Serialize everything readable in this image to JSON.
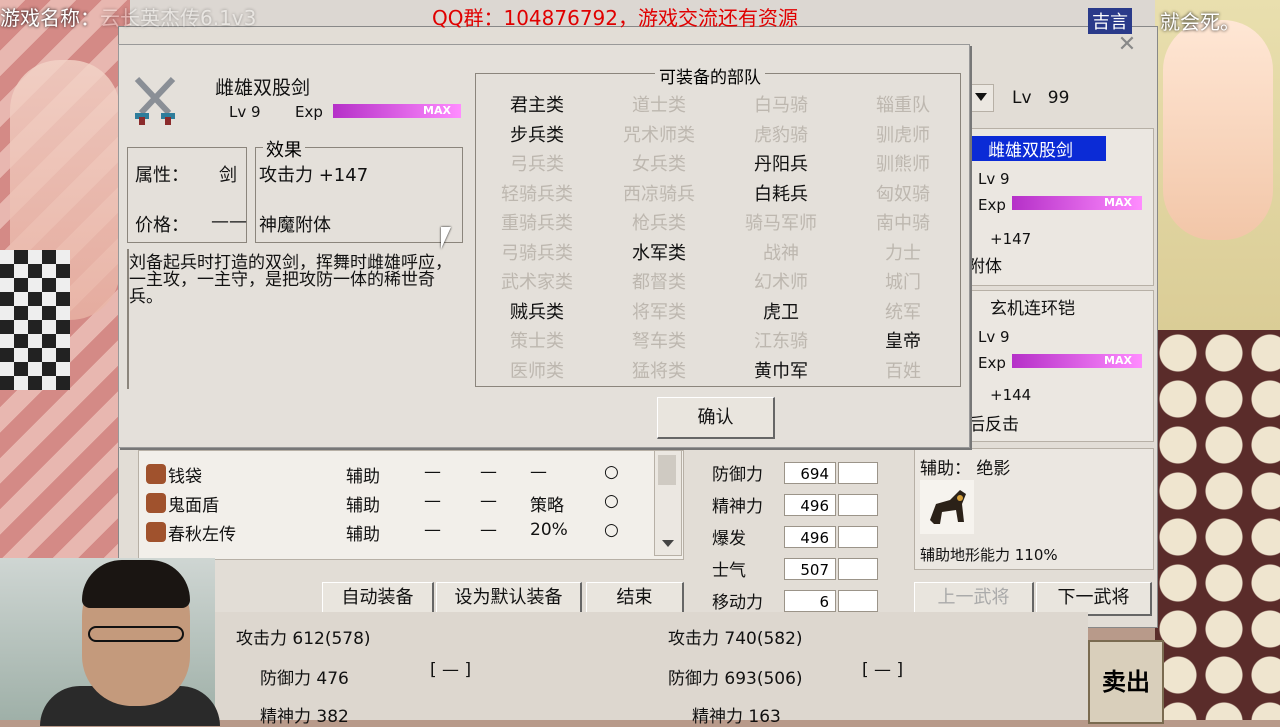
{
  "overlay": {
    "game_title": "游戏名称：",
    "game_name_partial": "云长英杰传6.1v3",
    "qq_banner": "QQ群：104876792，游戏交流还有资源",
    "right_caption": "就会死。",
    "right_tag": "吉言"
  },
  "modal": {
    "item_name": "雌雄双股剑",
    "lv_label": "Lv",
    "lv_value": "9",
    "exp_label": "Exp",
    "exp_max": "MAX",
    "attr_label": "属性：",
    "attr_value": "剑",
    "price_label": "价格：",
    "price_value": "——",
    "effect_title": "效果",
    "effect_line1": "攻击力 +147",
    "effect_line2": "神魔附体",
    "description": "刘备起兵时打造的双剑，挥舞时雌雄呼应，一主攻，一主守，是把攻防一体的稀世奇兵。",
    "units_title": "可装备的部队",
    "confirm_label": "确认",
    "units": [
      [
        "君主类",
        "道士类",
        "白马骑",
        "辎重队"
      ],
      [
        "步兵类",
        "咒术师类",
        "虎豹骑",
        "驯虎师"
      ],
      [
        "弓兵类",
        "女兵类",
        "丹阳兵",
        "驯熊师"
      ],
      [
        "轻骑兵类",
        "西凉骑兵",
        "白耗兵",
        "匈奴骑"
      ],
      [
        "重骑兵类",
        "枪兵类",
        "骑马军师",
        "南中骑"
      ],
      [
        "弓骑兵类",
        "水军类",
        "战神",
        "力士"
      ],
      [
        "武术家类",
        "都督类",
        "幻术师",
        "城门"
      ],
      [
        "贼兵类",
        "将军类",
        "虎卫",
        "统军"
      ],
      [
        "策士类",
        "弩车类",
        "江东骑",
        "皇帝"
      ],
      [
        "医师类",
        "猛将类",
        "黄巾军",
        "百姓"
      ]
    ],
    "units_enabled": [
      [
        true,
        false,
        false,
        false
      ],
      [
        true,
        false,
        false,
        false
      ],
      [
        false,
        false,
        true,
        false
      ],
      [
        false,
        false,
        true,
        false
      ],
      [
        false,
        false,
        false,
        false
      ],
      [
        false,
        true,
        false,
        false
      ],
      [
        false,
        false,
        false,
        false
      ],
      [
        true,
        false,
        true,
        false
      ],
      [
        false,
        false,
        false,
        true
      ],
      [
        false,
        false,
        true,
        false
      ]
    ]
  },
  "right_panel": {
    "lv_top_label": "Lv",
    "lv_top_value": "99",
    "weapon_name": "雌雄双股剑",
    "weapon_lv": "Lv 9",
    "weapon_exp_label": "Exp",
    "weapon_exp_max": "MAX",
    "weapon_atk": "+147",
    "weapon_effect_partial": "附体",
    "armor_name": "玄机连环铠",
    "armor_lv": "Lv 9",
    "armor_exp_label": "Exp",
    "armor_exp_max": "MAX",
    "armor_def": "+144",
    "armor_effect_partial": "后反击",
    "assist_label": "辅助：",
    "assist_name": "绝影",
    "assist_terrain": "辅助地形能力 110%",
    "prev_general": "上一武将",
    "next_general": "下一武将"
  },
  "item_list": {
    "rows": [
      {
        "name": "钱袋",
        "type": "辅助",
        "c1": "—",
        "c2": "—",
        "c3": "—",
        "mark": "○"
      },
      {
        "name": "鬼面盾",
        "type": "辅助",
        "c1": "—",
        "c2": "—",
        "c3": "策略",
        "mark": "○"
      },
      {
        "name": "春秋左传",
        "type": "辅助",
        "c1": "—",
        "c2": "—",
        "c3": "20%",
        "mark": "○"
      }
    ]
  },
  "stats": [
    {
      "label": "防御力",
      "value": "694"
    },
    {
      "label": "精神力",
      "value": "496"
    },
    {
      "label": "爆发",
      "value": "496"
    },
    {
      "label": "士气",
      "value": "507"
    },
    {
      "label": "移动力",
      "value": "6"
    }
  ],
  "buttons": {
    "auto_equip": "自动装备",
    "set_default": "设为默认装备",
    "finish": "结束"
  },
  "compare": {
    "left_atk": "攻击力 612(578)",
    "left_def": "防御力 476",
    "left_spi": "精神力 382",
    "left_slot": "[ — ]",
    "right_atk": "攻击力 740(582)",
    "right_def": "防御力 693(506)",
    "right_spi": "精神力 163",
    "right_slot": "[ — ]"
  },
  "sell_label": "卖出"
}
